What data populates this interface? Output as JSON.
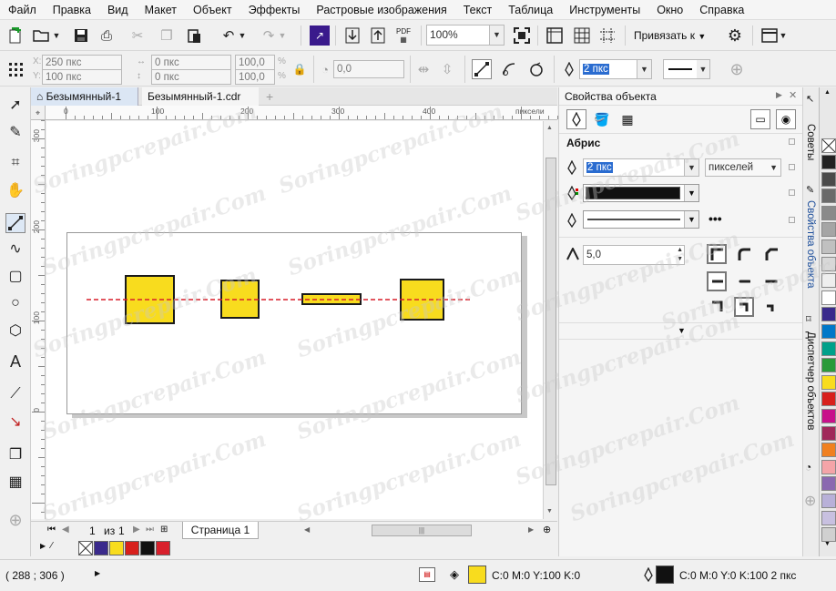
{
  "menu": [
    "Файл",
    "Правка",
    "Вид",
    "Макет",
    "Объект",
    "Эффекты",
    "Растровые изображения",
    "Текст",
    "Таблица",
    "Инструменты",
    "Окно",
    "Справка"
  ],
  "toolbar": {
    "pdf_label": "PDF",
    "zoom": "100%",
    "snap_label": "Привязать к"
  },
  "propbar": {
    "x": "250 пкс",
    "y": "100 пкс",
    "w": "0 пкс",
    "h": "0 пкс",
    "scale_x": "100,0",
    "scale_y": "100,0",
    "pct": "%",
    "angle": "0,0",
    "outline_width": "2 пкс"
  },
  "doc_tabs": [
    "Безымянный-1",
    "Безымянный-1.cdr"
  ],
  "ruler": {
    "h_ticks": [
      "0",
      "100",
      "200",
      "300",
      "400"
    ],
    "units": "пиксели",
    "v_ticks": [
      "300",
      "200",
      "100",
      "0"
    ]
  },
  "page_nav": {
    "current": "1",
    "of": "из",
    "total": "1",
    "page_tab": "Страница 1"
  },
  "doc_palette": [
    "#3a2a8c",
    "#f8dc1e",
    "#d8201c",
    "#111111",
    "#d8202c"
  ],
  "shapes": {
    "fill": "#f8dc1e",
    "stroke": "#1a1a1a",
    "guide_color": "#d81e2a"
  },
  "dock": {
    "title": "Свойства объекта",
    "section": "Абрис",
    "width_value": "2 пкс",
    "units": "пикселей",
    "miter_limit": "5,0",
    "outline_color": "#111111"
  },
  "side_tabs": [
    "Советы",
    "Свойства объекта",
    "Диспетчер объектов"
  ],
  "color_palette": [
    "#222222",
    "#4a4a4a",
    "#6a6a6a",
    "#8a8a8a",
    "#a5a5a5",
    "#c0c0c0",
    "#d8d8d8",
    "#eeeeee",
    "#ffffff",
    "#3a2a8c",
    "#0078c8",
    "#00a08a",
    "#2a9a3a",
    "#f8dc1e",
    "#d8201c",
    "#c8108a",
    "#a0285a",
    "#f08020",
    "#f4a4a8",
    "#8a68b0",
    "#b8b0d8",
    "#c8c0e0",
    "#d0d0d0"
  ],
  "status": {
    "coords": "( 288  ; 306   )",
    "fill_text": "C:0 M:0 Y:100 K:0",
    "outline_text": "C:0 M:0 Y:0 K:100  2 пкс",
    "fill_color": "#f8dc1e",
    "outline_color": "#111111"
  },
  "watermark": "Soringpcrepair.Com"
}
